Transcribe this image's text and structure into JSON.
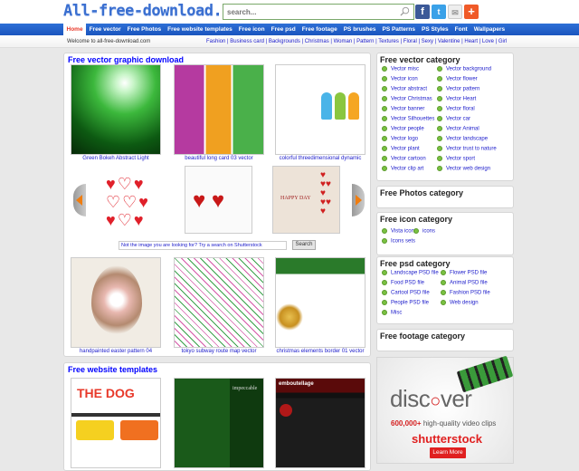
{
  "header": {
    "logo": "All-free-download.com",
    "search_placeholder": "search...",
    "social": [
      {
        "name": "facebook-icon",
        "glyph": "f",
        "color": "#3b5998"
      },
      {
        "name": "twitter-icon",
        "glyph": "t",
        "color": "#3aa1e8"
      },
      {
        "name": "mail-icon",
        "glyph": "✉",
        "color": "#e0e0e0"
      },
      {
        "name": "add-icon",
        "glyph": "+",
        "color": "#f05a28"
      }
    ]
  },
  "nav": {
    "items": [
      "Home",
      "Free vector",
      "Free Photos",
      "Free website templates",
      "Free icon",
      "Free psd",
      "Free footage",
      "PS brushes",
      "PS Patterns",
      "PS Styles",
      "Font",
      "Wallpapers"
    ],
    "active": "Home"
  },
  "subbar": {
    "welcome": "Welcome to all-free-download.com",
    "tags": "Fashion | Business card | Backgrounds | Christmas | Woman | Pattern | Textures | Floral | Sexy | Valentine | Heart | Love | Girl"
  },
  "vector_section": {
    "title": "Free vector graphic download",
    "row1": [
      "Green Bokeh Abstract Light",
      "beautiful long card 03 vector",
      "colorful threedimensional dynamic"
    ],
    "row3": [
      "handpainted easter pattern 04",
      "tokyo subway route map vector",
      "christmas elements border 01 vector"
    ],
    "shutterstock_prompt": "Not the image you are looking for? Try a search on Shutterstock",
    "search_button": "Search"
  },
  "templates_section": {
    "title": "Free website templates",
    "template_texts": [
      "THE DOG",
      "impeccable",
      "emboutellage"
    ]
  },
  "sidebar": {
    "vector": {
      "title": "Free vector category",
      "col1": [
        "Vector misc",
        "Vector icon",
        "Vector abstract",
        "Vector Christmas",
        "Vector banner",
        "Vector Silhouettes",
        "Vector people",
        "Vector logo",
        "Vector plant",
        "Vector cartoon",
        "Vector clip art"
      ],
      "col2": [
        "Vector background",
        "Vector flower",
        "Vector pattern",
        "Vector Heart",
        "Vector floral",
        "Vector car",
        "Vector Animal",
        "Vector landscape",
        "Vector trust to nature",
        "Vector sport",
        "Vector web design"
      ]
    },
    "photos": {
      "title": "Free Photos category"
    },
    "icon": {
      "title": "Free icon category",
      "col1": [
        "Vista icon",
        "Icons sets"
      ],
      "col2": [
        "icons"
      ]
    },
    "psd": {
      "title": "Free psd category",
      "col1": [
        "Landscape PSD file",
        "Food PSD file",
        "Cartool PSD file",
        "People PSD file",
        "Misc"
      ],
      "col2": [
        "Flower PSD file",
        "Animal PSD file",
        "Fashion PSD file",
        "Web design"
      ]
    },
    "footage": {
      "title": "Free footage category"
    }
  },
  "ad": {
    "headline": "disc ver",
    "sub": "600,000+",
    "sub2": " high-quality video clips",
    "brand": "shutterstock",
    "button": "Learn More"
  }
}
